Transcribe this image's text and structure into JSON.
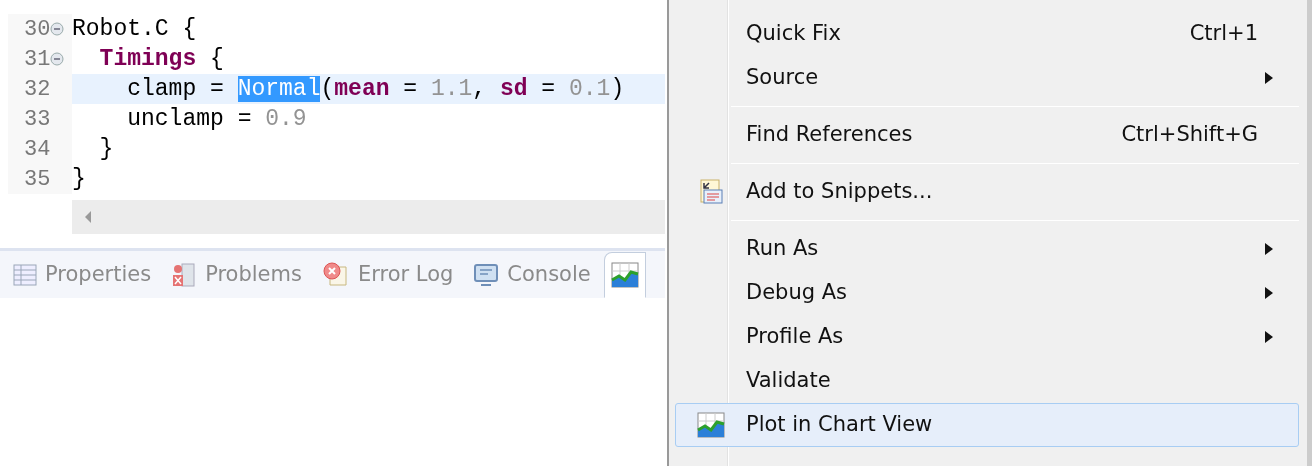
{
  "editor": {
    "lines": [
      {
        "number": "30",
        "fold": true,
        "highlighted": false,
        "segments": [
          {
            "kind": "plain",
            "text": "Robot.C {"
          }
        ]
      },
      {
        "number": "31",
        "fold": true,
        "highlighted": false,
        "segments": [
          {
            "kind": "keyword",
            "text": "  Timings"
          },
          {
            "kind": "plain",
            "text": " {"
          }
        ]
      },
      {
        "number": "32",
        "fold": false,
        "highlighted": true,
        "segments": [
          {
            "kind": "plain",
            "text": "    clamp = "
          },
          {
            "kind": "selected",
            "text": "Normal"
          },
          {
            "kind": "plain",
            "text": "("
          },
          {
            "kind": "keyword",
            "text": "mean"
          },
          {
            "kind": "plain",
            "text": " = "
          },
          {
            "kind": "number",
            "text": "1.1"
          },
          {
            "kind": "plain",
            "text": ", "
          },
          {
            "kind": "keyword",
            "text": "sd"
          },
          {
            "kind": "plain",
            "text": " = "
          },
          {
            "kind": "number",
            "text": "0.1"
          },
          {
            "kind": "plain",
            "text": ")"
          }
        ]
      },
      {
        "number": "33",
        "fold": false,
        "highlighted": false,
        "segments": [
          {
            "kind": "plain",
            "text": "    unclamp = "
          },
          {
            "kind": "number",
            "text": "0.9"
          }
        ]
      },
      {
        "number": "34",
        "fold": false,
        "highlighted": false,
        "segments": [
          {
            "kind": "plain",
            "text": "  }"
          }
        ]
      },
      {
        "number": "35",
        "fold": false,
        "highlighted": false,
        "segments": [
          {
            "kind": "plain",
            "text": "}"
          }
        ]
      }
    ]
  },
  "bottom_tabs": [
    {
      "label": "Properties",
      "selected": false
    },
    {
      "label": "Problems",
      "selected": false
    },
    {
      "label": "Error Log",
      "selected": false
    },
    {
      "label": "Console",
      "selected": false
    },
    {
      "selected": true
    }
  ],
  "context_menu": [
    {
      "kind": "item",
      "label": "Quick Fix",
      "shortcut": "Ctrl+1",
      "submenu": false,
      "selected": false
    },
    {
      "kind": "item",
      "label": "Source",
      "submenu": true,
      "selected": false
    },
    {
      "kind": "separator"
    },
    {
      "kind": "item",
      "label": "Find References",
      "shortcut": "Ctrl+Shift+G",
      "submenu": false,
      "selected": false
    },
    {
      "kind": "separator"
    },
    {
      "kind": "item",
      "label": "Add to Snippets...",
      "submenu": false,
      "selected": false
    },
    {
      "kind": "separator"
    },
    {
      "kind": "item",
      "label": "Run As",
      "submenu": true,
      "selected": false
    },
    {
      "kind": "item",
      "label": "Debug As",
      "submenu": true,
      "selected": false
    },
    {
      "kind": "item",
      "label": "Profile As",
      "submenu": true,
      "selected": false
    },
    {
      "kind": "item",
      "label": "Validate",
      "submenu": false,
      "selected": false
    },
    {
      "kind": "item",
      "label": "Plot in Chart View",
      "submenu": false,
      "selected": true
    }
  ]
}
